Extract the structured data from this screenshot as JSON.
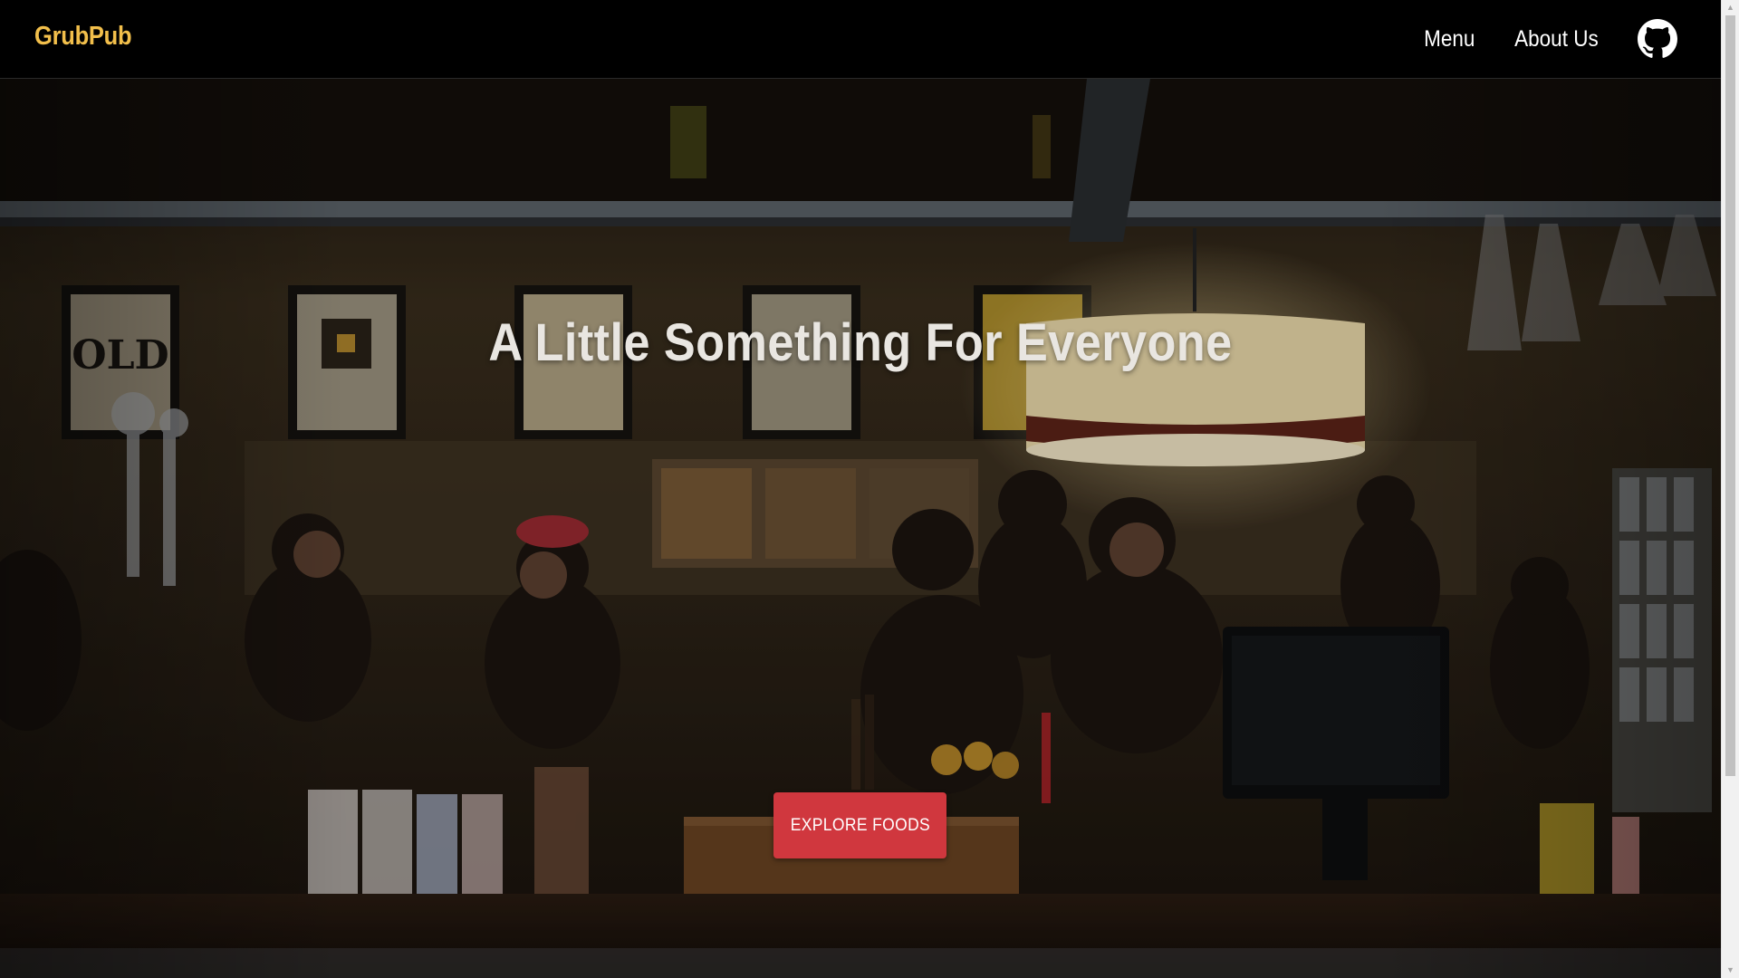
{
  "nav": {
    "brand": "GrubPub",
    "links": [
      "Menu",
      "About Us"
    ],
    "github_icon": "github-icon"
  },
  "hero": {
    "title": "A Little Something For Everyone",
    "cta_label": "EXPLORE FOODS",
    "background": "restaurant-bar-photo"
  },
  "colors": {
    "brand": "#f2bf4b",
    "navbar_bg": "#000000",
    "cta_bg": "#d0373e",
    "title": "#e9e6e1"
  },
  "scrollbar": {
    "up_icon": "scroll-up-arrow",
    "down_icon": "scroll-down-arrow"
  }
}
